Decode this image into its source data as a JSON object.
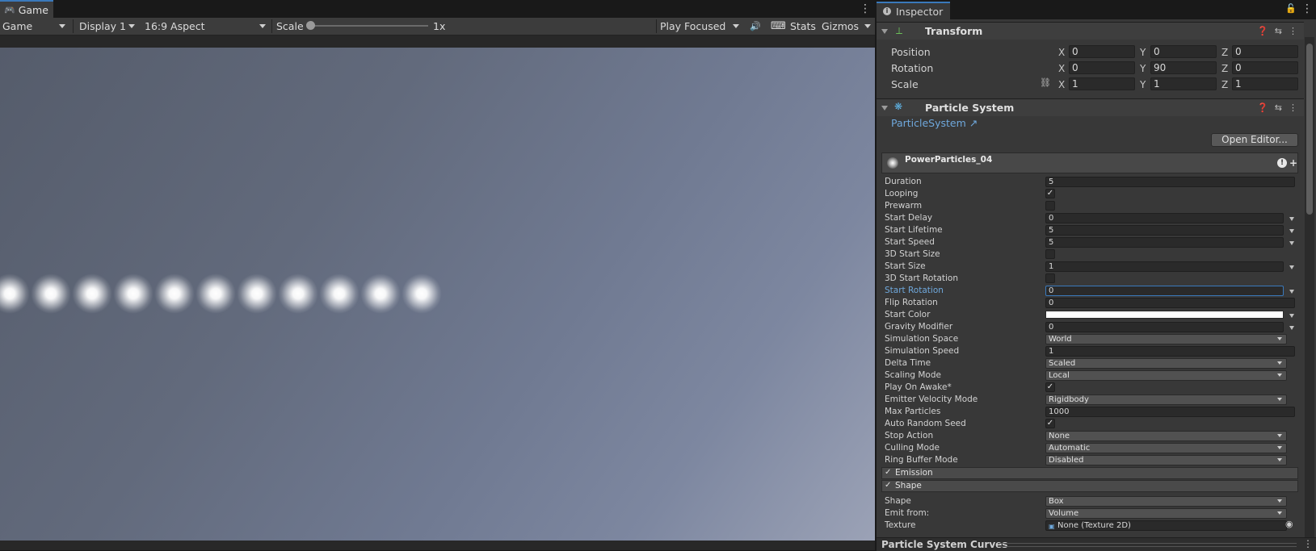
{
  "game": {
    "tab_label": "Game",
    "toolbar": {
      "mode": "Game",
      "display": "Display 1",
      "aspect": "16:9 Aspect",
      "scale_label": "Scale",
      "scale_value": "1x",
      "play_mode": "Play Focused",
      "stats": "Stats",
      "gizmos": "Gizmos"
    },
    "particle_count": 11
  },
  "inspector": {
    "tab_label": "Inspector",
    "transform": {
      "title": "Transform",
      "position_label": "Position",
      "rotation_label": "Rotation",
      "scale_label": "Scale",
      "position": {
        "x": "0",
        "y": "0",
        "z": "0"
      },
      "rotation": {
        "x": "0",
        "y": "90",
        "z": "0"
      },
      "scale": {
        "x": "1",
        "y": "1",
        "z": "1"
      },
      "axis_x": "X",
      "axis_y": "Y",
      "axis_z": "Z"
    },
    "particle_system": {
      "title": "Particle System",
      "script_link": "ParticleSystem",
      "open_editor": "Open Editor...",
      "asset_name": "PowerParticles_04",
      "rows": {
        "duration": {
          "label": "Duration",
          "value": "5"
        },
        "looping": {
          "label": "Looping",
          "check": "✓"
        },
        "prewarm": {
          "label": "Prewarm"
        },
        "start_delay": {
          "label": "Start Delay",
          "value": "0"
        },
        "start_lifetime": {
          "label": "Start Lifetime",
          "value": "5"
        },
        "start_speed": {
          "label": "Start Speed",
          "value": "5"
        },
        "start_size_3d": {
          "label": "3D Start Size"
        },
        "start_size": {
          "label": "Start Size",
          "value": "1"
        },
        "start_rotation_3d": {
          "label": "3D Start Rotation"
        },
        "start_rotation": {
          "label": "Start Rotation",
          "value": "0"
        },
        "flip_rotation": {
          "label": "Flip Rotation",
          "value": "0"
        },
        "start_color": {
          "label": "Start Color",
          "color": "#ffffff"
        },
        "gravity_modifier": {
          "label": "Gravity Modifier",
          "value": "0"
        },
        "simulation_space": {
          "label": "Simulation Space",
          "value": "World"
        },
        "simulation_speed": {
          "label": "Simulation Speed",
          "value": "1"
        },
        "delta_time": {
          "label": "Delta Time",
          "value": "Scaled"
        },
        "scaling_mode": {
          "label": "Scaling Mode",
          "value": "Local"
        },
        "play_on_awake": {
          "label": "Play On Awake*",
          "check": "✓"
        },
        "emitter_velocity_mode": {
          "label": "Emitter Velocity Mode",
          "value": "Rigidbody"
        },
        "max_particles": {
          "label": "Max Particles",
          "value": "1000"
        },
        "auto_random_seed": {
          "label": "Auto Random Seed",
          "check": "✓"
        },
        "stop_action": {
          "label": "Stop Action",
          "value": "None"
        },
        "culling_mode": {
          "label": "Culling Mode",
          "value": "Automatic"
        },
        "ring_buffer_mode": {
          "label": "Ring Buffer Mode",
          "value": "Disabled"
        }
      },
      "modules": {
        "emission": {
          "label": "Emission",
          "check": "✓"
        },
        "shape": {
          "label": "Shape",
          "check": "✓"
        }
      },
      "shape_rows": {
        "shape": {
          "label": "Shape",
          "value": "Box"
        },
        "emit_from": {
          "label": "Emit from:",
          "value": "Volume"
        },
        "texture": {
          "label": "Texture",
          "value": "None (Texture 2D)"
        }
      }
    },
    "curves_title": "Particle System Curves"
  },
  "colors": {
    "accent": "#3a79bb",
    "link": "#6fa8dc",
    "panel": "#383838"
  }
}
